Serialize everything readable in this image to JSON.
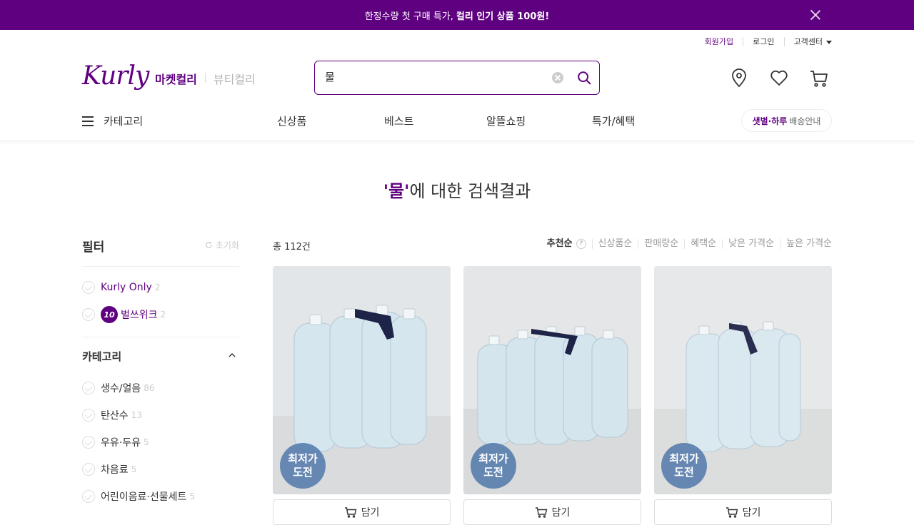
{
  "banner": {
    "text": "한정수량 첫 구매 특가,",
    "highlight": "컬리 인기 상품 100원!"
  },
  "util": {
    "signup": "회원가입",
    "login": "로그인",
    "support": "고객센터"
  },
  "header": {
    "logo": "Kurly",
    "mall_market": "마켓컬리",
    "mall_beauty": "뷰티컬리"
  },
  "search": {
    "value": "물"
  },
  "gnb": {
    "category": "카테고리",
    "items": [
      "신상품",
      "베스트",
      "알뜰쇼핑",
      "특가/혜택"
    ],
    "delivery_highlight": "샛별·하루",
    "delivery_text": "배송안내"
  },
  "result": {
    "keyword": "'물'",
    "suffix": "에 대한 검색결과"
  },
  "filter": {
    "title": "필터",
    "reset": "초기화",
    "top_options": [
      {
        "label": "Kurly Only",
        "count": "2"
      },
      {
        "label": "벌쓰위크",
        "count": "2",
        "badge": "10"
      }
    ],
    "category_title": "카테고리",
    "categories": [
      {
        "label": "생수/얼음",
        "count": "86"
      },
      {
        "label": "탄산수",
        "count": "13"
      },
      {
        "label": "우유·두유",
        "count": "5"
      },
      {
        "label": "차음료",
        "count": "5"
      },
      {
        "label": "어린이음료·선물세트",
        "count": "5"
      }
    ]
  },
  "list": {
    "total": "총 112건",
    "sorts": [
      "추천순",
      "신상품순",
      "판매량순",
      "혜택순",
      "낮은 가격순",
      "높은 가격순"
    ],
    "help": "?",
    "badge_line1": "최저가",
    "badge_line2": "도전",
    "cart_label": "담기"
  }
}
